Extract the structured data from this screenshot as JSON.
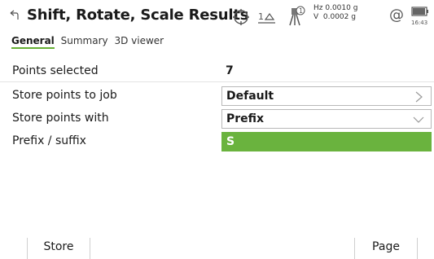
{
  "header": {
    "title": "Shift, Rotate, Scale Results",
    "back_icon": "back-arrow-icon",
    "status": {
      "hz_line": "Hz 0.0010 g",
      "v_line": "V  0.0002 g",
      "target_count": "1",
      "prism_count": "1",
      "time": "16:43"
    }
  },
  "tabs": [
    {
      "label": "General",
      "active": true
    },
    {
      "label": "Summary",
      "active": false
    },
    {
      "label": "3D viewer",
      "active": false
    }
  ],
  "form": {
    "points_selected": {
      "label": "Points selected",
      "value": "7"
    },
    "store_to_job": {
      "label": "Store points to job",
      "value": "Default",
      "icon": "chevron-right-icon"
    },
    "store_with": {
      "label": "Store points with",
      "value": "Prefix",
      "icon": "chevron-down-icon"
    },
    "prefix_suffix": {
      "label": "Prefix / suffix",
      "value": "S"
    }
  },
  "softkeys": {
    "left": "Store",
    "right": "Page"
  },
  "colors": {
    "accent_green": "#6ab33e",
    "field_border": "#b8b8b8"
  }
}
